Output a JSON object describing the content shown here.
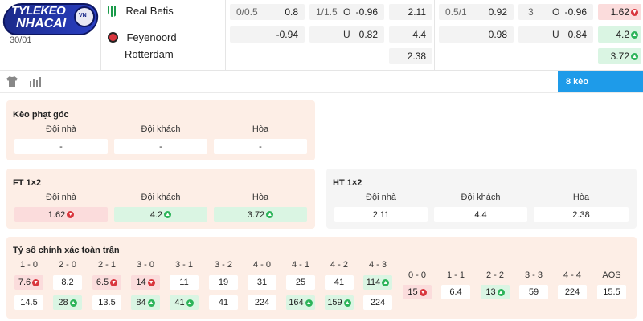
{
  "logo": {
    "line1": "TYLEKEO",
    "line2": "NHACAI",
    "badge": "VN"
  },
  "match": {
    "date": "30/01",
    "home": "Real Betis",
    "away_line1": "Feyenoord",
    "away_line2": "Rotterdam"
  },
  "odds_rows": {
    "row1": {
      "hcap": "0/0.5",
      "hcap_val": "0.8",
      "ou": "1/1.5",
      "ou_side": "O",
      "ou_val": "-0.96",
      "x12": "2.11",
      "h1_hcap": "0.5/1",
      "h1_val": "0.92",
      "h1_ou": "3",
      "h1_ou_side": "O",
      "h1_ou_val": "-0.96",
      "h1_x12": "1.62"
    },
    "row2": {
      "hcap_val": "-0.94",
      "ou_side": "U",
      "ou_val": "0.82",
      "x12": "4.4",
      "h1_val": "0.98",
      "h1_ou_side": "U",
      "h1_ou_val": "0.84",
      "h1_x12": "4.2"
    },
    "row3": {
      "x12": "2.38",
      "h1_x12": "3.72"
    }
  },
  "toolbar": {
    "jersey_icon": "shirt-icon",
    "stats_icon": "chart-icon",
    "keo_button": "8 kèo"
  },
  "corner": {
    "title": "Kèo phạt góc",
    "labels": [
      "Đội nhà",
      "Đội khách",
      "Hòa"
    ],
    "values": [
      "-",
      "-",
      "-"
    ]
  },
  "ft": {
    "title": "FT 1×2",
    "labels": [
      "Đội nhà",
      "Đội khách",
      "Hòa"
    ],
    "values": [
      "1.62",
      "4.2",
      "3.72"
    ]
  },
  "ht": {
    "title": "HT 1×2",
    "labels": [
      "Đội nhà",
      "Đội khách",
      "Hòa"
    ],
    "values": [
      "2.11",
      "4.4",
      "2.38"
    ]
  },
  "correct_score": {
    "title": "Tỷ số chính xác toàn trận",
    "home_labels": [
      "1 - 0",
      "2 - 0",
      "2 - 1",
      "3 - 0",
      "3 - 1",
      "3 - 2",
      "4 - 0",
      "4 - 1",
      "4 - 2",
      "4 - 3"
    ],
    "home_values": [
      "7.6",
      "8.2",
      "6.5",
      "14",
      "11",
      "19",
      "31",
      "25",
      "41",
      "114"
    ],
    "away_values": [
      "14.5",
      "28",
      "13.5",
      "84",
      "41",
      "41",
      "224",
      "164",
      "159",
      "224"
    ],
    "draw_labels": [
      "0 - 0",
      "1 - 1",
      "2 - 2",
      "3 - 3",
      "4 - 4",
      "AOS"
    ],
    "draw_values": [
      "15",
      "6.4",
      "13",
      "59",
      "224",
      "15.5"
    ]
  },
  "colors": {
    "accent_blue": "#1e9be9",
    "panel_orange": "#fdeee6",
    "down_red": "#d9363e",
    "up_green": "#2db45a"
  }
}
